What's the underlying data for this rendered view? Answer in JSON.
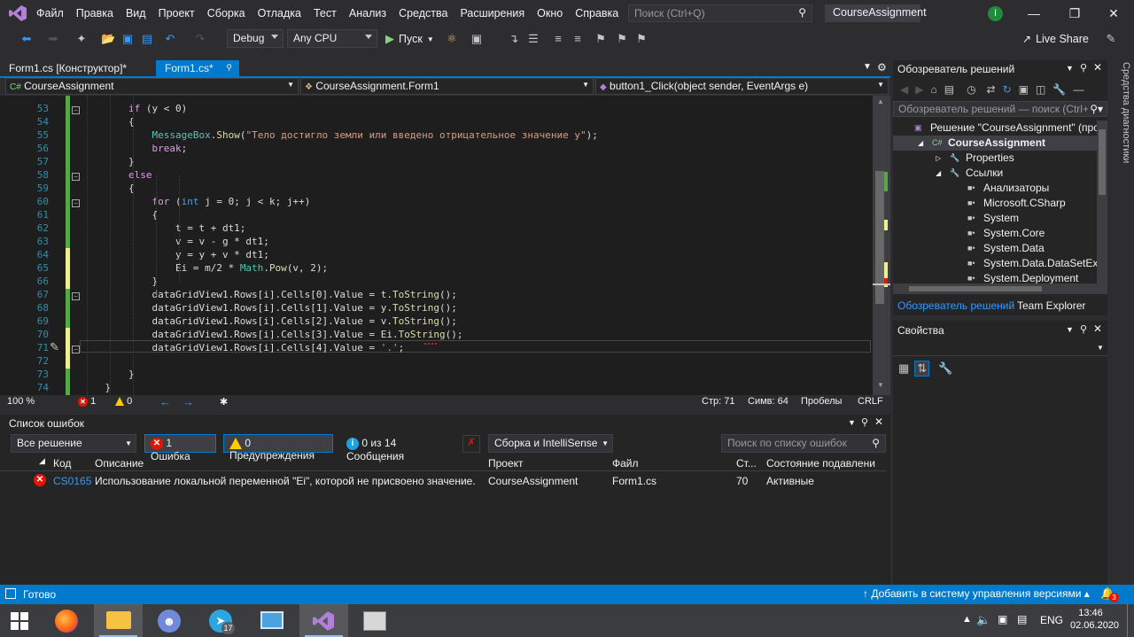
{
  "menu": [
    "Файл",
    "Правка",
    "Вид",
    "Проект",
    "Сборка",
    "Отладка",
    "Тест",
    "Анализ",
    "Средства",
    "Расширения",
    "Окно",
    "Справка"
  ],
  "search_placeholder": "Поиск (Ctrl+Q)",
  "solution_name": "CourseAssignment",
  "account_initial": "I",
  "toolbar": {
    "config": "Debug",
    "platform": "Any CPU",
    "run": "Пуск",
    "live_share": "Live Share"
  },
  "tabs": [
    {
      "label": "Form1.cs [Конструктор]*",
      "active": false
    },
    {
      "label": "Form1.cs*",
      "active": true
    }
  ],
  "nav": {
    "project": "CourseAssignment",
    "class": "CourseAssignment.Form1",
    "member": "button1_Click(object sender, EventArgs e)"
  },
  "code_lines": [
    {
      "n": "53",
      "html": "        <span class='ctl'>if</span> (y &lt; 0)"
    },
    {
      "n": "54",
      "html": "        {"
    },
    {
      "n": "55",
      "html": "            <span class='cls'>MessageBox</span>.<span class='mth'>Show</span>(<span class='str'>\"Тело достигло земли или введено отрицательное значение y\"</span>);"
    },
    {
      "n": "56",
      "html": "            <span class='ctl'>break</span>;"
    },
    {
      "n": "57",
      "html": "        }"
    },
    {
      "n": "58",
      "html": "        <span class='ctl'>else</span>"
    },
    {
      "n": "59",
      "html": "        {"
    },
    {
      "n": "60",
      "html": "            <span class='ctl'>for</span> (<span class='kw'>int</span> j = 0; j &lt; k; j++)"
    },
    {
      "n": "61",
      "html": "            {"
    },
    {
      "n": "62",
      "html": "                t = t + dt1;"
    },
    {
      "n": "63",
      "html": "                v = v - g * dt1;"
    },
    {
      "n": "64",
      "html": "                y = y + v * dt1;"
    },
    {
      "n": "65",
      "html": "                Ei = m/2 * <span class='cls'>Math</span>.<span class='mth'>Pow</span>(v, 2);"
    },
    {
      "n": "66",
      "html": "            }"
    },
    {
      "n": "67",
      "html": "            dataGridView1.Rows[i].Cells[0].Value = t.<span class='mth'>ToString</span>();"
    },
    {
      "n": "68",
      "html": "            dataGridView1.Rows[i].Cells[1].Value = y.<span class='mth'>ToString</span>();"
    },
    {
      "n": "69",
      "html": "            dataGridView1.Rows[i].Cells[2].Value = v.<span class='mth'>ToString</span>();"
    },
    {
      "n": "70",
      "html": "            dataGridView1.Rows[i].Cells[3].Value = Ei.<span class='mth'>ToString</span>();"
    },
    {
      "n": "71",
      "html": "            dataGridView1.Rows[i].Cells[4].Value = <span class='str'>'.'</span>;"
    },
    {
      "n": "72",
      "html": ""
    },
    {
      "n": "73",
      "html": "        }"
    },
    {
      "n": "74",
      "html": "    }"
    }
  ],
  "edit_status": {
    "zoom": "100 %",
    "errors": "1",
    "warnings": "0",
    "line": "Стр: 71",
    "col": "Симв: 64",
    "spaces": "Пробелы",
    "eol": "CRLF"
  },
  "error_list": {
    "title": "Список ошибок",
    "scope": "Все решение",
    "errors_btn": "1 Ошибка",
    "warnings_btn": "0 Предупреждения",
    "messages_btn": "0 из 14 Сообщения",
    "build_filter": "Сборка и IntelliSense",
    "search_placeholder": "Поиск по списку ошибок",
    "columns": [
      "Код",
      "Описание",
      "Проект",
      "Файл",
      "Ст...",
      "Состояние подавлени"
    ],
    "rows": [
      {
        "code": "CS0165",
        "desc": "Использование локальной переменной \"Ei\", которой не присвоено значение.",
        "project": "CourseAssignment",
        "file": "Form1.cs",
        "line": "70",
        "state": "Активные"
      }
    ]
  },
  "solution_explorer": {
    "title": "Обозреватель решений",
    "search_placeholder": "Обозреватель решений — поиск (Ctrl+;)",
    "tree": [
      {
        "label": "Решение \"CourseAssignment\" (проект",
        "level": 0,
        "bold": false
      },
      {
        "label": "CourseAssignment",
        "level": 1,
        "bold": true
      },
      {
        "label": "Properties",
        "level": 2,
        "bold": false
      },
      {
        "label": "Ссылки",
        "level": 2,
        "bold": false
      },
      {
        "label": "Анализаторы",
        "level": 3,
        "bold": false
      },
      {
        "label": "Microsoft.CSharp",
        "level": 3,
        "bold": false
      },
      {
        "label": "System",
        "level": 3,
        "bold": false
      },
      {
        "label": "System.Core",
        "level": 3,
        "bold": false
      },
      {
        "label": "System.Data",
        "level": 3,
        "bold": false
      },
      {
        "label": "System.Data.DataSetExtension",
        "level": 3,
        "bold": false
      },
      {
        "label": "System.Deployment",
        "level": 3,
        "bold": false
      }
    ],
    "tab_solution": "Обозреватель решений",
    "tab_team": "Team Explorer"
  },
  "properties_title": "Свойства",
  "side_tab": "Средства диагностики",
  "status": {
    "ready": "Готово",
    "vcs": "Добавить в систему управления версиями",
    "notifications": "3"
  },
  "taskbar": {
    "telegram_badge": "17",
    "lang": "ENG",
    "time": "13:46",
    "date": "02.06.2020"
  }
}
